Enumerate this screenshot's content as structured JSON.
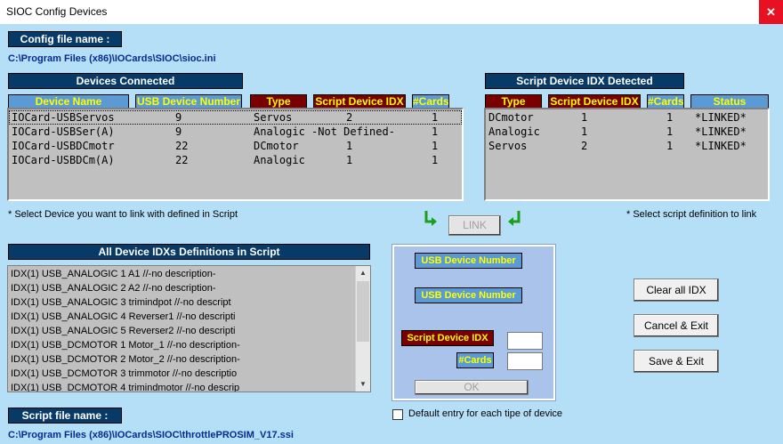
{
  "window": {
    "title": "SIOC Config Devices",
    "close_glyph": "✕"
  },
  "config": {
    "label": "Config file name :",
    "path": "C:\\Program Files (x86)\\IOCards\\SIOC\\sioc.ini"
  },
  "devices": {
    "label": "Devices Connected",
    "headers": [
      "Device Name",
      "USB Device Number",
      "Type",
      "Script Device IDX",
      "#Cards"
    ],
    "rows": [
      {
        "name": "IOCard-USBServos",
        "usb": "9",
        "type": "Servos",
        "idx": "2",
        "cards": "1"
      },
      {
        "name": "IOCard-USBSer(A)",
        "usb": "9",
        "type": "Analogic -Not Defined-",
        "idx": "",
        "cards": "1"
      },
      {
        "name": "IOCard-USBDCmotr",
        "usb": "22",
        "type": "DCmotor",
        "idx": "1",
        "cards": "1"
      },
      {
        "name": "IOCard-USBDCm(A)",
        "usb": "22",
        "type": "Analogic",
        "idx": "1",
        "cards": "1"
      }
    ],
    "note": "* Select Device  you want to link with defined in Script"
  },
  "script_idx": {
    "label": "Script Device IDX Detected",
    "headers": [
      "Type",
      "Script Device IDX",
      "#Cards",
      "Status"
    ],
    "rows": [
      {
        "type": "DCmotor",
        "idx": "1",
        "cards": "1",
        "status": "*LINKED*"
      },
      {
        "type": "Analogic",
        "idx": "1",
        "cards": "1",
        "status": "*LINKED*"
      },
      {
        "type": "Servos",
        "idx": "2",
        "cards": "1",
        "status": "*LINKED*"
      }
    ],
    "note": "* Select script definition to link"
  },
  "link": {
    "label": "LINK"
  },
  "definitions": {
    "label": "All Device IDXs Definitions in Script",
    "items": [
      "IDX(1)  USB_ANALOGIC 1 A1 //-no description-",
      "IDX(1)  USB_ANALOGIC 2 A2 //-no description-",
      "IDX(1)  USB_ANALOGIC 3 trimindpot //-no descript",
      "IDX(1)  USB_ANALOGIC 4 Reverser1 //-no descripti",
      "IDX(1)  USB_ANALOGIC 5 Reverser2 //-no descripti",
      "IDX(1)  USB_DCMOTOR 1 Motor_1 //-no description-",
      "IDX(1)  USB_DCMOTOR 2 Motor_2 //-no description-",
      "IDX(1)  USB_DCMOTOR 3 trimmotor //-no descriptio",
      "IDX(1)  USB_DCMOTOR 4 trimindmotor //-no descrip"
    ]
  },
  "form": {
    "usb1_label": "USB Device Number",
    "usb2_label": "USB Device Number",
    "idx_label": "Script Device IDX",
    "cards_label": "#Cards",
    "idx_value": "",
    "cards_value": "",
    "ok_label": "OK"
  },
  "default_entry": {
    "label": "Default entry for each tipe of device",
    "checked": false
  },
  "buttons": {
    "clear": "Clear all IDX",
    "cancel": "Cancel & Exit",
    "save": "Save & Exit"
  },
  "script_file": {
    "label": "Script file name :",
    "path": "C:\\Program Files (x86)\\IOCards\\SIOC\\throttlePROSIM_V17.ssi"
  },
  "colors": {
    "background": "#b4dff7",
    "header_blue": "#5b9bd5",
    "header_red": "#7a0000",
    "label_navy": "#083a68",
    "header_text": "#ffff00",
    "path_text": "#0a2a8f",
    "arrow_green": "#1aa01a"
  }
}
